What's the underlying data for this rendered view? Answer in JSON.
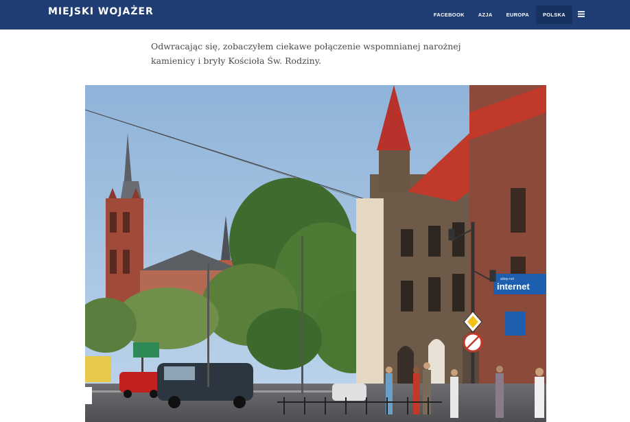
{
  "header": {
    "brand": "MIEJSKI WOJAŻER",
    "nav": [
      {
        "label": "FACEBOOK",
        "active": false
      },
      {
        "label": "AZJA",
        "active": false
      },
      {
        "label": "EUROPA",
        "active": false
      },
      {
        "label": "POLSKA",
        "active": true
      }
    ],
    "menu_icon": "hamburger-icon",
    "colors": {
      "bar": "#1f3d73",
      "active_tab": "#18325f"
    }
  },
  "article": {
    "paragraph": "Odwracając się, zobaczyłem ciekawe połączenie wspomnianej narożnej kamienicy i bryły Kościoła Św. Rodziny."
  },
  "photo": {
    "signs": {
      "shop": "internet",
      "shop_small": "sklep net"
    }
  }
}
